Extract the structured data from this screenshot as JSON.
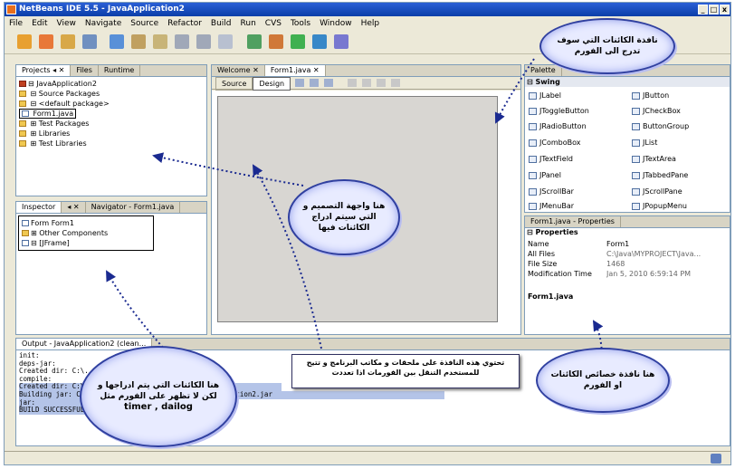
{
  "window": {
    "title": "NetBeans IDE 5.5 - JavaApplication2",
    "min": "_",
    "max": "□",
    "close": "x"
  },
  "menu": [
    "File",
    "Edit",
    "View",
    "Navigate",
    "Source",
    "Refactor",
    "Build",
    "Run",
    "CVS",
    "Tools",
    "Window",
    "Help"
  ],
  "projects": {
    "tabs": [
      "Projects ◂ ✕",
      "Files",
      "Runtime"
    ],
    "tree": [
      "⊟ JavaApplication2",
      "   ⊟ Source Packages",
      "      ⊟ <default package>",
      "         Form1.java",
      "   ⊞ Test Packages",
      "   ⊞ Libraries",
      "   ⊞ Test Libraries"
    ]
  },
  "inspector": {
    "tabs": [
      "Inspector",
      "◂ ✕",
      "Navigator - Form1.java"
    ],
    "tree": [
      "Form Form1",
      "⊞ Other Components",
      "⊟ [JFrame]"
    ]
  },
  "editor": {
    "tabs": [
      "Welcome ✕",
      "Form1.java ✕"
    ],
    "modes": [
      "Source",
      "Design"
    ]
  },
  "palette": {
    "title": "Palette",
    "section": "⊟ Swing",
    "items": [
      [
        "JLabel",
        "JButton"
      ],
      [
        "JToggleButton",
        "JCheckBox"
      ],
      [
        "JRadioButton",
        "ButtonGroup"
      ],
      [
        "JComboBox",
        "JList"
      ],
      [
        "JTextField",
        "JTextArea"
      ],
      [
        "JPanel",
        "JTabbedPane"
      ],
      [
        "JScrollBar",
        "JScrollPane"
      ],
      [
        "JMenuBar",
        "JPopupMenu"
      ]
    ]
  },
  "properties": {
    "title": "Form1.java - Properties",
    "section": "⊟ Properties",
    "rows": [
      [
        "Name",
        "Form1"
      ],
      [
        "All Files",
        "C:\\Java\\MYPROJECT\\Java..."
      ],
      [
        "File Size",
        "1468"
      ],
      [
        "Modification Time",
        "Jan 5, 2010 6:59:14 PM"
      ]
    ],
    "footer": "Form1.java"
  },
  "output": {
    "title": "Output - JavaApplication2 (clean...",
    "lines": [
      "init:",
      "deps-jar:",
      "Created dir: C:\\...",
      "compile:",
      "Created dir: C:\\...",
      "Building jar: C:\\...JavaApplication2\\dist\\JavaApplication2.jar",
      "jar:",
      "BUILD SUCCESSFUL (total time: 1 second)"
    ]
  },
  "annotations": {
    "palette_cloud": "نافذة الكائنات التي سوف تدرج الى الفورم",
    "design_cloud": "هنا واجهة التصميم و التي سيتم ادراج الكائنات فيها",
    "inspector_cloud_ar": "هنا الكائنات التي يتم ادراجها و لكن لا تظهر على الفورم مثل",
    "inspector_cloud_en": "timer , dailog",
    "projects_callout": "تحتوي هذه النافذة على ملحقات و مكاتب البرنامج و تتيح للمستخدم التنقل بين الفورمات اذا تعددت",
    "properties_cloud": "هنا نافذة خصائص الكائنات او الفورم"
  }
}
